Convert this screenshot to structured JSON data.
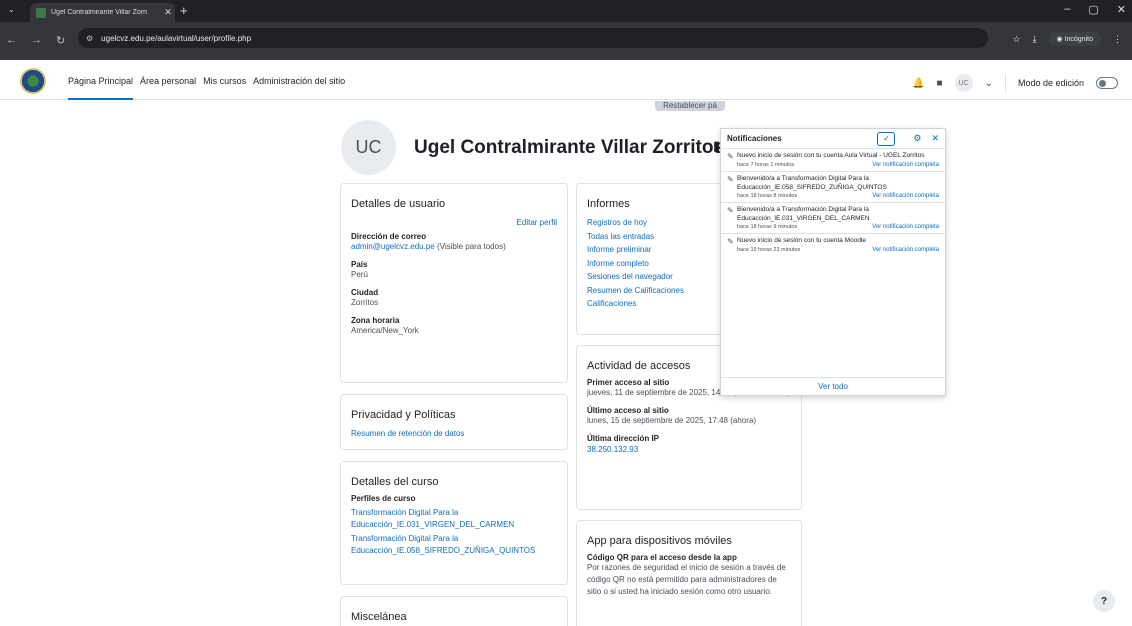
{
  "browser": {
    "tab_title": "Ugel Contralmirante Villar Zorri",
    "url": "ugelcvz.edu.pe/aulavirtual/user/profile.php",
    "incognito_label": "Incógnito"
  },
  "nav": {
    "items": [
      "Página Principal",
      "Área personal",
      "Mis cursos",
      "Administración del sitio"
    ],
    "user_initials": "UC",
    "edit_mode_label": "Modo de edición"
  },
  "profile": {
    "reset_button": "Restablecer pá",
    "initials": "UC",
    "fullname": "Ugel Contralmirante Villar Zorritos"
  },
  "user_details": {
    "title": "Detalles de usuario",
    "edit_link": "Editar perfil",
    "email_label": "Dirección de correo",
    "email": "admin@ugelcvz.edu.pe",
    "email_visibility": "(Visible para todos)",
    "country_label": "País",
    "country": "Perú",
    "city_label": "Ciudad",
    "city": "Zorritos",
    "timezone_label": "Zona horaria",
    "timezone": "America/New_York"
  },
  "privacy": {
    "title": "Privacidad y Políticas",
    "link": "Resumen de retención de datos"
  },
  "course_details": {
    "title": "Detalles del curso",
    "profiles_label": "Perfiles de curso",
    "courses": [
      "Transformación Digital Para la Educacción_IE.031_VIRGEN_DEL_CARMEN",
      "Transformación Digital Para la Educacción_IE.058_SIFREDO_ZUÑIGA_QUINTOS"
    ]
  },
  "misc": {
    "title": "Miscelánea"
  },
  "reports": {
    "title": "Informes",
    "links": [
      "Registros de hoy",
      "Todas las entradas",
      "Informe preliminar",
      "Informe completo",
      "Sesiones del navegador",
      "Resumen de Calificaciones",
      "Calificaciones"
    ]
  },
  "access": {
    "title": "Actividad de accesos",
    "first_label": "Primer acceso al sitio",
    "first_value": "jueves, 11 de septiembre de 2025, 14:03  (4 días 3 horas)",
    "last_label": "Último acceso al sitio",
    "last_value": "lunes, 15 de septiembre de 2025, 17:48  (ahora)",
    "ip_label": "Última dirección IP",
    "ip": "38.250.132.93"
  },
  "mobile": {
    "title": "App para dispositivos móviles",
    "qr_label": "Código QR para el acceso desde la app",
    "qr_text": "Por razones de seguridad el inicio de sesión a través de código QR no está permitido para administradores de sitio o si usted ha iniciado sesión como otro usuario."
  },
  "notifications": {
    "title": "Notificaciones",
    "see_all": "Ver todo",
    "items": [
      {
        "message": "Nuevo inicio de sesión con tu cuenta Aula Virtual - UGEL Zorritos",
        "time": "hace 7 horas 1 minutos",
        "link": "Ver notificación completa"
      },
      {
        "message": "Bienvenido/a a Transformación Digital Para la Educacción_IE.058_SIFREDO_ZUÑIGA_QUINTOS",
        "time": "hace 18 horas 8 minutos",
        "link": "Ver notificación completa"
      },
      {
        "message": "Bienvenido/a a Transformación Digital Para la Educacción_IE.031_VIRGEN_DEL_CARMEN",
        "time": "hace 18 horas 9 minutos",
        "link": "Ver notificación completa"
      },
      {
        "message": "Nuevo inicio de sesión con tu cuenta Moodle",
        "time": "hace 19 horas 23 minutos",
        "link": "Ver notificación completa"
      }
    ]
  },
  "help_label": "?"
}
